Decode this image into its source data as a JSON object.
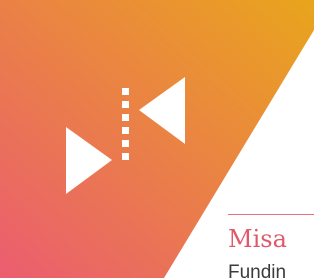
{
  "colors": {
    "gradient_start": "#eb5d70",
    "gradient_end": "#e9a51c",
    "accent": "#e0596b",
    "icon": "#ffffff"
  },
  "icon": {
    "name": "flip-horizontal-icon"
  },
  "card": {
    "title": "Misa",
    "subtitle": "Fundin"
  }
}
